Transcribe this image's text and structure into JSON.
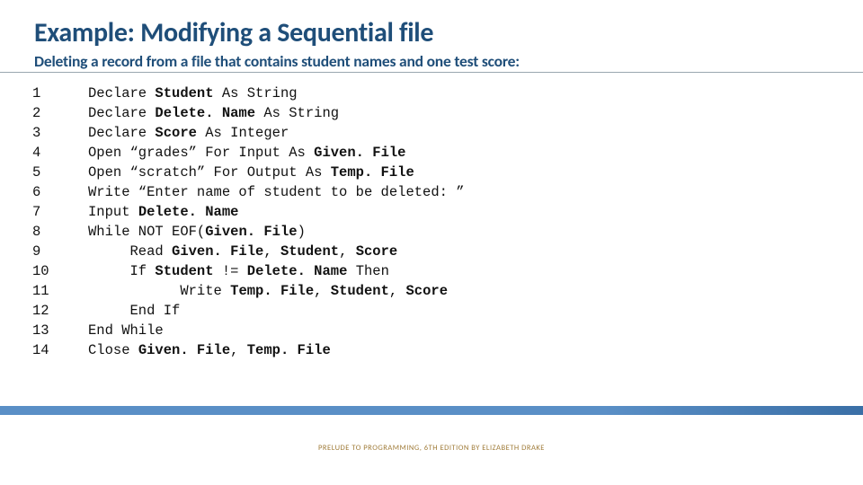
{
  "title": "Example: Modifying a Sequential file",
  "subtitle": "Deleting a record from a file that contains student names and one test score:",
  "code": [
    {
      "n": "1",
      "t": "Declare <b>Student</b> As String"
    },
    {
      "n": "2",
      "t": "Declare <b>Delete. Name</b> As String"
    },
    {
      "n": "3",
      "t": "Declare <b>Score</b> As Integer"
    },
    {
      "n": "4",
      "t": "Open “grades” For Input As <b>Given. File</b>"
    },
    {
      "n": "5",
      "t": "Open “scratch” For Output As <b>Temp. File</b>"
    },
    {
      "n": "6",
      "t": "Write “Enter name of student to be deleted: ”"
    },
    {
      "n": "7",
      "t": "Input <b>Delete. Name</b>"
    },
    {
      "n": "8",
      "t": "While NOT EOF(<b>Given. File</b>)"
    },
    {
      "n": "9",
      "t": "     Read <b>Given. File</b>, <b>Student</b>, <b>Score</b>"
    },
    {
      "n": "10",
      "t": "     If <b>Student</b> != <b>Delete. Name</b> Then"
    },
    {
      "n": "11",
      "t": "           Write <b>Temp. File</b>, <b>Student</b>, <b>Score</b>"
    },
    {
      "n": "12",
      "t": "     End If"
    },
    {
      "n": "13",
      "t": "End While"
    },
    {
      "n": "14",
      "t": "Close <b>Given. File</b>, <b>Temp. File</b>"
    }
  ],
  "footer": "PRELUDE TO PROGRAMMING, 6TH EDITION BY ELIZABETH DRAKE"
}
